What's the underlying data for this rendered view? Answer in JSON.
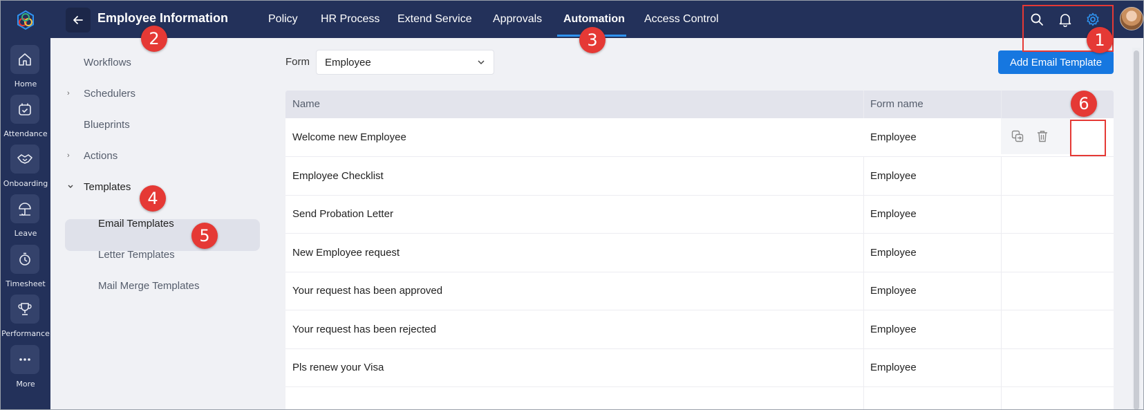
{
  "rail": {
    "items": [
      {
        "label": "Home",
        "icon": "home-icon"
      },
      {
        "label": "Attendance",
        "icon": "calendar-check-icon"
      },
      {
        "label": "Onboarding",
        "icon": "handshake-icon"
      },
      {
        "label": "Leave",
        "icon": "umbrella-icon"
      },
      {
        "label": "Timesheet",
        "icon": "stopwatch-icon"
      },
      {
        "label": "Performance",
        "icon": "trophy-icon"
      },
      {
        "label": "More",
        "icon": "ellipsis-icon"
      }
    ]
  },
  "header": {
    "title": "Employee Information",
    "tabs": [
      "Policy",
      "HR Process",
      "Extend Service",
      "Approvals",
      "Automation",
      "Access Control"
    ],
    "active_tab": "Automation",
    "accent": "#2f93f0"
  },
  "subnav": {
    "items": [
      "Workflows",
      "Schedulers",
      "Blueprints",
      "Actions",
      "Templates"
    ],
    "children": [
      "Email Templates",
      "Letter Templates",
      "Mail Merge Templates"
    ],
    "active": "Email Templates"
  },
  "main": {
    "form_label": "Form",
    "form_value": "Employee",
    "add_button": "Add Email Template",
    "columns": [
      "Name",
      "Form name"
    ],
    "rows": [
      {
        "name": "Welcome new Employee",
        "form": "Employee"
      },
      {
        "name": "Employee Checklist",
        "form": "Employee"
      },
      {
        "name": "Send Probation Letter",
        "form": "Employee"
      },
      {
        "name": "New Employee request",
        "form": "Employee"
      },
      {
        "name": "Your request has been approved",
        "form": "Employee"
      },
      {
        "name": "Your request has been rejected",
        "form": "Employee"
      },
      {
        "name": "Pls renew your Visa",
        "form": "Employee"
      }
    ]
  },
  "callouts": [
    "1",
    "2",
    "3",
    "4",
    "5",
    "6"
  ],
  "colors": {
    "brand": "#23315a",
    "button": "#1677e0",
    "callout": "#e53935"
  }
}
